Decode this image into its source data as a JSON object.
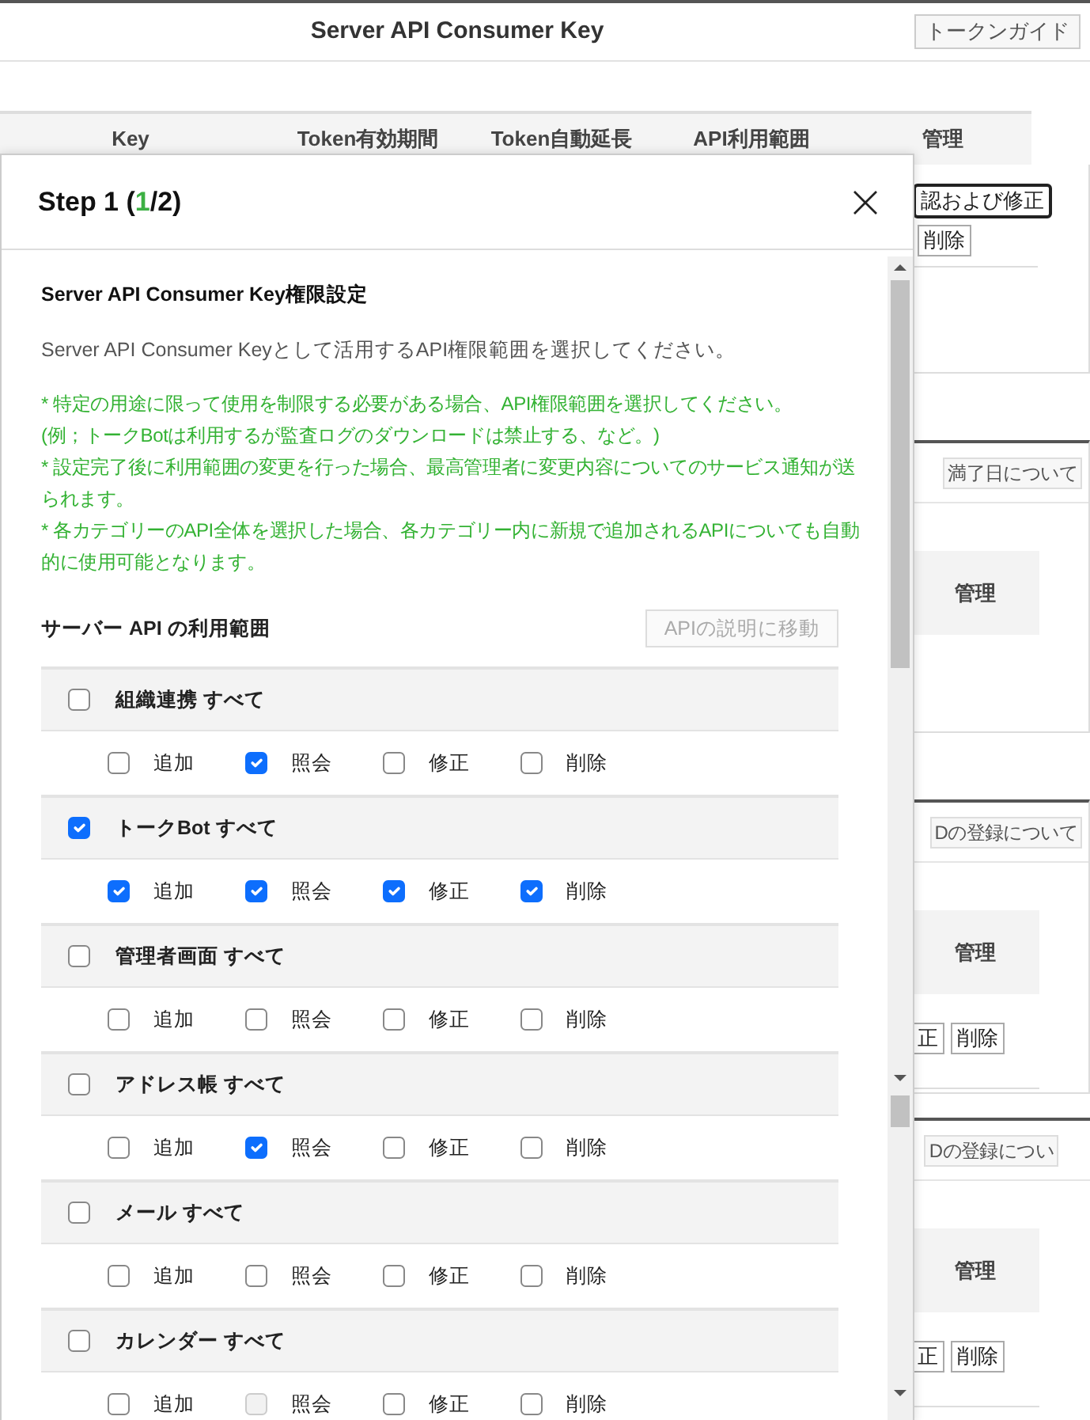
{
  "page": {
    "title": "Server API Consumer Key",
    "guide_button": "トークンガイド",
    "table_columns": [
      "Key",
      "Token有効期間",
      "Token自動延長",
      "API利用範囲",
      "管理"
    ],
    "side_sections": [
      {
        "actions": [
          {
            "label": "認および修正",
            "focused": true
          },
          {
            "label": "削除",
            "focused": false
          }
        ]
      },
      {
        "button": "満了日について",
        "header": "管理"
      },
      {
        "button": "Dの登録について",
        "header": "管理",
        "actions": [
          {
            "label": "正",
            "focused": false
          },
          {
            "label": "削除",
            "focused": false
          }
        ]
      },
      {
        "button": "Dの登録につい",
        "header": "管理",
        "actions": [
          {
            "label": "正",
            "focused": false
          },
          {
            "label": "削除",
            "focused": false
          }
        ]
      }
    ]
  },
  "modal": {
    "step": {
      "before": "Step 1 (",
      "current": "1",
      "after": "/2)"
    },
    "heading": "Server API Consumer Key権限設定",
    "description": "Server API Consumer Keyとして活用するAPI権限範囲を選択してください。",
    "notes": [
      "* 特定の用途に限って使用を制限する必要がある場合、API権限範囲を選択してください。",
      "(例；トークBotは利用するが監査ログのダウンロードは禁止する、など。)",
      "* 設定完了後に利用範囲の変更を行った場合、最高管理者に変更内容についてのサービス通知が送られます。",
      "* 各カテゴリーのAPI全体を選択した場合、各カテゴリー内に新規で追加されるAPIについても自動的に使用可能となります。"
    ],
    "scope_title": "サーバー API の利用範囲",
    "doc_button": "APIの説明に移動",
    "categories": [
      {
        "label": "組織連携 すべて",
        "checked": false,
        "permissions": [
          {
            "label": "追加",
            "checked": false,
            "disabled": false
          },
          {
            "label": "照会",
            "checked": true,
            "disabled": false
          },
          {
            "label": "修正",
            "checked": false,
            "disabled": false
          },
          {
            "label": "削除",
            "checked": false,
            "disabled": false
          }
        ]
      },
      {
        "label": "トークBot すべて",
        "checked": true,
        "permissions": [
          {
            "label": "追加",
            "checked": true,
            "disabled": false
          },
          {
            "label": "照会",
            "checked": true,
            "disabled": false
          },
          {
            "label": "修正",
            "checked": true,
            "disabled": false
          },
          {
            "label": "削除",
            "checked": true,
            "disabled": false
          }
        ]
      },
      {
        "label": "管理者画面 すべて",
        "checked": false,
        "permissions": [
          {
            "label": "追加",
            "checked": false,
            "disabled": false
          },
          {
            "label": "照会",
            "checked": false,
            "disabled": false
          },
          {
            "label": "修正",
            "checked": false,
            "disabled": false
          },
          {
            "label": "削除",
            "checked": false,
            "disabled": false
          }
        ]
      },
      {
        "label": "アドレス帳 すべて",
        "checked": false,
        "permissions": [
          {
            "label": "追加",
            "checked": false,
            "disabled": false
          },
          {
            "label": "照会",
            "checked": true,
            "disabled": false
          },
          {
            "label": "修正",
            "checked": false,
            "disabled": false
          },
          {
            "label": "削除",
            "checked": false,
            "disabled": false
          }
        ]
      },
      {
        "label": "メール すべて",
        "checked": false,
        "permissions": [
          {
            "label": "追加",
            "checked": false,
            "disabled": false
          },
          {
            "label": "照会",
            "checked": false,
            "disabled": false
          },
          {
            "label": "修正",
            "checked": false,
            "disabled": false
          },
          {
            "label": "削除",
            "checked": false,
            "disabled": false
          }
        ]
      },
      {
        "label": "カレンダー すべて",
        "checked": false,
        "permissions": [
          {
            "label": "追加",
            "checked": false,
            "disabled": false
          },
          {
            "label": "照会",
            "checked": false,
            "disabled": true
          },
          {
            "label": "修正",
            "checked": false,
            "disabled": false
          },
          {
            "label": "削除",
            "checked": false,
            "disabled": false
          }
        ]
      }
    ]
  }
}
